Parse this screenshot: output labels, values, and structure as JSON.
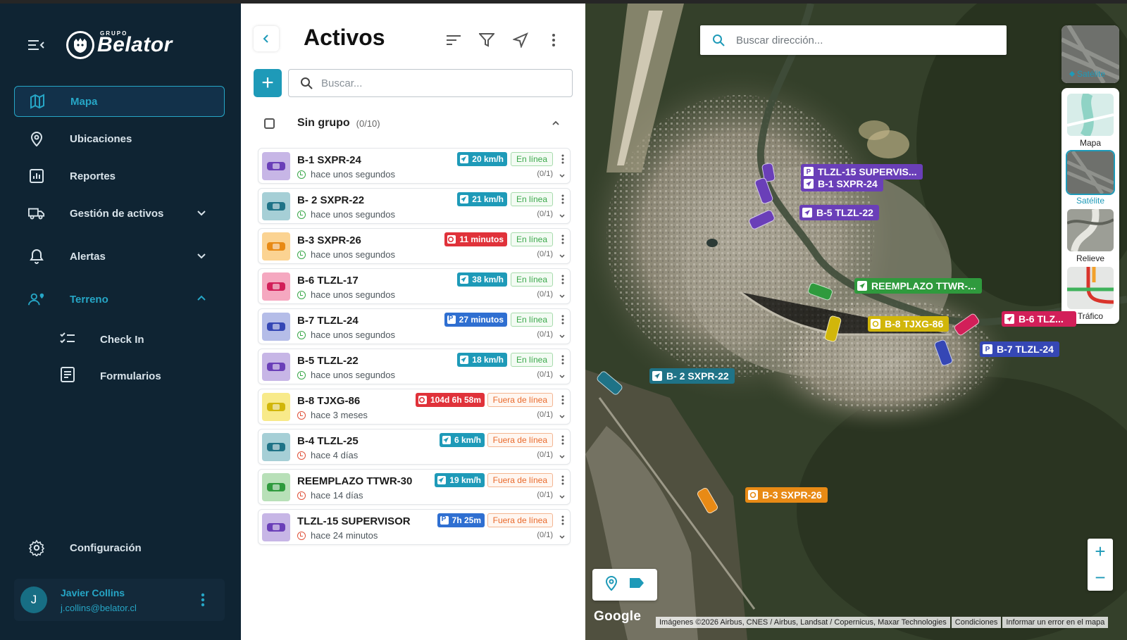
{
  "brand": {
    "small": "GRUPO",
    "name": "Belator"
  },
  "nav": {
    "mapa": "Mapa",
    "ubicaciones": "Ubicaciones",
    "reportes": "Reportes",
    "gestion": "Gestión de activos",
    "alertas": "Alertas",
    "terreno": "Terreno",
    "checkin": "Check In",
    "formularios": "Formularios",
    "configuracion": "Configuración"
  },
  "user": {
    "initial": "J",
    "name": "Javier Collins",
    "email": "j.collins@belator.cl"
  },
  "panel": {
    "title": "Activos",
    "search_placeholder": "Buscar...",
    "add_label": "+",
    "group": {
      "name": "Sin grupo",
      "count": "(0/10)"
    }
  },
  "assets": [
    {
      "name": "B-1 SXPR-24",
      "time": "hace unos segundos",
      "speed": "20 km/h",
      "status": "En línea",
      "frac": "(0/1)",
      "veh_color": "#c7b6e6",
      "car_color": "#6a3fb8"
    },
    {
      "name": "B- 2 SXPR-22",
      "time": "hace unos segundos",
      "speed": "21 km/h",
      "status": "En línea",
      "frac": "(0/1)",
      "veh_color": "#a6cfd6",
      "car_color": "#1f7387"
    },
    {
      "name": "B-3 SXPR-26",
      "time": "hace unos segundos",
      "speed": "11 minutos",
      "status": "En línea",
      "frac": "(0/1)",
      "veh_color": "#fbd392",
      "car_color": "#e88a15"
    },
    {
      "name": "B-6 TLZL-17",
      "time": "hace unos segundos",
      "speed": "38 km/h",
      "status": "En línea",
      "frac": "(0/1)",
      "veh_color": "#f5a8c0",
      "car_color": "#d21f59"
    },
    {
      "name": "B-7 TLZL-24",
      "time": "hace unos segundos",
      "speed": "27 minutos",
      "status": "En línea",
      "frac": "(0/1)",
      "veh_color": "#b5bde8",
      "car_color": "#3547b5"
    },
    {
      "name": "B-5 TLZL-22",
      "time": "hace unos segundos",
      "speed": "18 km/h",
      "status": "En línea",
      "frac": "(0/1)",
      "veh_color": "#c7b6e6",
      "car_color": "#6a3fb8"
    },
    {
      "name": "B-8 TJXG-86",
      "time": "hace 3 meses",
      "speed": "104d 6h 58m",
      "status": "Fuera de línea",
      "frac": "(0/1)",
      "veh_color": "#f8ea8a",
      "car_color": "#d1b60a"
    },
    {
      "name": "B-4 TLZL-25",
      "time": "hace 4 días",
      "speed": "6 km/h",
      "status": "Fuera de línea",
      "frac": "(0/1)",
      "veh_color": "#a6cfd6",
      "car_color": "#1f7387"
    },
    {
      "name": "REEMPLAZO TTWR-30",
      "time": "hace 14 días",
      "speed": "19 km/h",
      "status": "Fuera de línea",
      "frac": "(0/1)",
      "veh_color": "#b8e0b8",
      "car_color": "#2f9a3d"
    },
    {
      "name": "TLZL-15 SUPERVISOR",
      "time": "hace 24 minutos",
      "speed": "7h 25m",
      "status": "Fuera de línea",
      "frac": "(0/1)",
      "veh_color": "#c7b6e6",
      "car_color": "#6a3fb8"
    }
  ],
  "map": {
    "search_placeholder": "Buscar dirección...",
    "layer_current": "Satélite",
    "layers": [
      "Mapa",
      "Satélite",
      "Relieve",
      "Tráfico"
    ],
    "zoom_in": "+",
    "zoom_out": "−",
    "google": "Google",
    "attribution": "Imágenes ©2026 Airbus, CNES / Airbus, Landsat / Copernicus, Maxar Technologies",
    "terms": "Condiciones",
    "report": "Informar un error en el mapa",
    "labels": [
      {
        "text": "TLZL-15 SUPERVIS...",
        "icon": "P"
      },
      {
        "text": "B-1 SXPR-24",
        "icon": "nav"
      },
      {
        "text": "B-5 TLZL-22",
        "icon": "nav"
      },
      {
        "text": "REEMPLAZO TTWR-...",
        "icon": "nav"
      },
      {
        "text": "B-8 TJXG-86",
        "icon": "stop"
      },
      {
        "text": "B-6 TLZ...",
        "icon": "nav"
      },
      {
        "text": "B-7 TLZL-24",
        "icon": "P"
      },
      {
        "text": "B- 2 SXPR-22",
        "icon": "nav"
      },
      {
        "text": "B-3 SXPR-26",
        "icon": "stop"
      }
    ]
  },
  "colors": {
    "accent": "#1e9ab8",
    "sidebar_bg": "#0f2433",
    "badge_moving": "#1e9ab8",
    "badge_stopped": "#e0323a",
    "badge_parked": "#2f6fd1",
    "online": "#3aa84a",
    "offline": "#e96a2c"
  }
}
